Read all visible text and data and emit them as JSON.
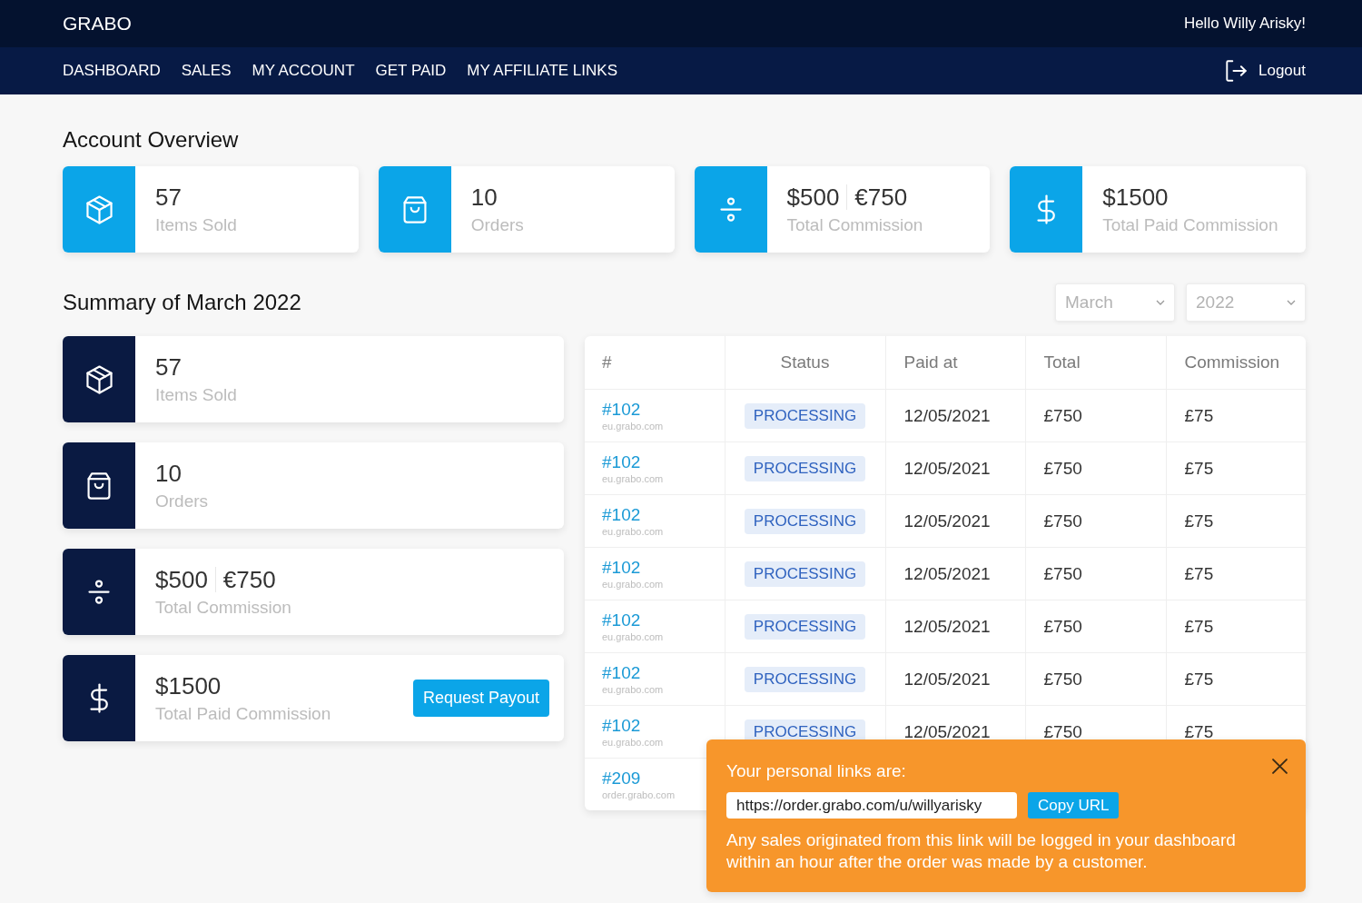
{
  "header": {
    "logo": "GRABO",
    "greeting": "Hello Willy Arisky!"
  },
  "nav": {
    "items": [
      "DASHBOARD",
      "SALES",
      "MY ACCOUNT",
      "GET PAID",
      "MY AFFILIATE LINKS"
    ],
    "logout": "Logout"
  },
  "account_overview": {
    "title": "Account Overview",
    "cards": [
      {
        "values": [
          "57"
        ],
        "label": "Items Sold"
      },
      {
        "values": [
          "10"
        ],
        "label": "Orders"
      },
      {
        "values": [
          "$500",
          "€750"
        ],
        "label": "Total Commission"
      },
      {
        "values": [
          "$1500"
        ],
        "label": "Total Paid Commission"
      }
    ]
  },
  "summary": {
    "title": "Summary of March 2022",
    "month_select": {
      "value": "March"
    },
    "year_select": {
      "value": "2022"
    },
    "cards": [
      {
        "values": [
          "57"
        ],
        "label": "Items Sold"
      },
      {
        "values": [
          "10"
        ],
        "label": "Orders"
      },
      {
        "values": [
          "$500",
          "€750"
        ],
        "label": "Total Commission"
      },
      {
        "values": [
          "$1500"
        ],
        "label": "Total Paid Commission",
        "button": "Request Payout"
      }
    ]
  },
  "orders_table": {
    "columns": [
      "#",
      "Status",
      "Paid at",
      "Total",
      "Commission"
    ],
    "rows": [
      {
        "order": "#102",
        "domain": "eu.grabo.com",
        "status": "PROCESSING",
        "paid_at": "12/05/2021",
        "total": "£750",
        "commission": "£75"
      },
      {
        "order": "#102",
        "domain": "eu.grabo.com",
        "status": "PROCESSING",
        "paid_at": "12/05/2021",
        "total": "£750",
        "commission": "£75"
      },
      {
        "order": "#102",
        "domain": "eu.grabo.com",
        "status": "PROCESSING",
        "paid_at": "12/05/2021",
        "total": "£750",
        "commission": "£75"
      },
      {
        "order": "#102",
        "domain": "eu.grabo.com",
        "status": "PROCESSING",
        "paid_at": "12/05/2021",
        "total": "£750",
        "commission": "£75"
      },
      {
        "order": "#102",
        "domain": "eu.grabo.com",
        "status": "PROCESSING",
        "paid_at": "12/05/2021",
        "total": "£750",
        "commission": "£75"
      },
      {
        "order": "#102",
        "domain": "eu.grabo.com",
        "status": "PROCESSING",
        "paid_at": "12/05/2021",
        "total": "£750",
        "commission": "£75"
      },
      {
        "order": "#102",
        "domain": "eu.grabo.com",
        "status": "PROCESSING",
        "paid_at": "12/05/2021",
        "total": "£750",
        "commission": "£75"
      },
      {
        "order": "#209",
        "domain": "order.grabo.com"
      }
    ]
  },
  "links_popup": {
    "title": "Your personal links are:",
    "url": "https://order.grabo.com/u/willyarisky",
    "copy_button": "Copy URL",
    "note": "Any sales originated from this link will be logged in your dashboard within an hour after the order was made by a customer."
  }
}
